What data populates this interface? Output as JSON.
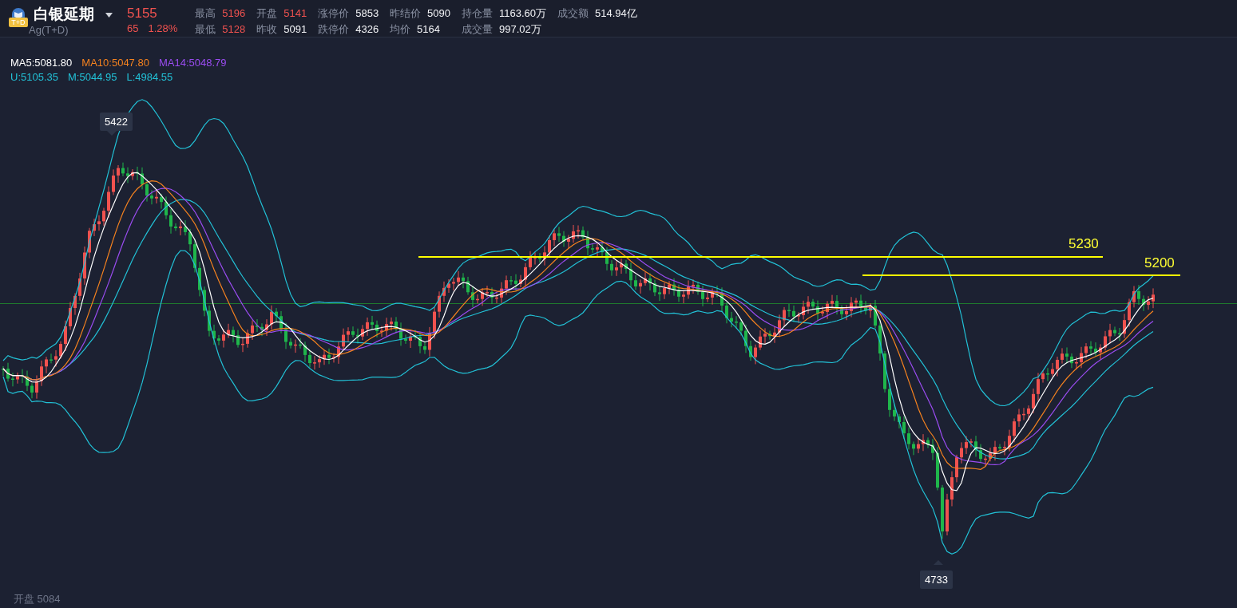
{
  "instrument": {
    "logo_badge": "T+D",
    "name": "白银延期",
    "code": "Ag(T+D)",
    "price": "5155",
    "change": "65",
    "change_pct": "1.28%"
  },
  "stats": [
    [
      {
        "label": "最高",
        "value": "5196",
        "rising": true
      },
      {
        "label": "最低",
        "value": "5128",
        "rising": true
      }
    ],
    [
      {
        "label": "开盘",
        "value": "5141",
        "rising": true
      },
      {
        "label": "昨收",
        "value": "5091",
        "rising": false
      }
    ],
    [
      {
        "label": "涨停价",
        "value": "5853",
        "rising": false
      },
      {
        "label": "跌停价",
        "value": "4326",
        "rising": false
      }
    ],
    [
      {
        "label": "昨结价",
        "value": "5090",
        "rising": false
      },
      {
        "label": "均价",
        "value": "5164",
        "rising": false
      }
    ],
    [
      {
        "label": "持仓量",
        "value": "1163.60万",
        "rising": false
      },
      {
        "label": "成交量",
        "value": "997.02万",
        "rising": false
      }
    ],
    [
      {
        "label": "成交额",
        "value": "514.94亿",
        "rising": false
      }
    ]
  ],
  "legend": [
    [
      {
        "text": "MA5:5081.80",
        "color": "#ffffff"
      },
      {
        "text": "MA10:5047.80",
        "color": "#f5821f"
      },
      {
        "text": "MA14:5048.79",
        "color": "#9a4cf0"
      }
    ],
    [
      {
        "text": "U:5105.35",
        "color": "#22c1d6"
      },
      {
        "text": "M:5044.95",
        "color": "#22c1d6"
      },
      {
        "text": "L:4984.55",
        "color": "#22c1d6"
      }
    ]
  ],
  "chart": {
    "high_marker": "5422",
    "low_marker": "4733",
    "levels": [
      {
        "text": "5230"
      },
      {
        "text": "5200"
      }
    ],
    "footer": "开盘 5084"
  }
}
